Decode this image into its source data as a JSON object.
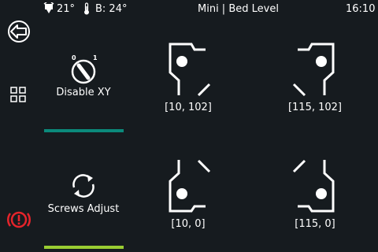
{
  "status": {
    "extruder_icon": "extruder-nozzle-icon",
    "extruder_temp": "21°",
    "bed_icon": "thermometer-icon",
    "bed_temp": "B: 24°",
    "title": "Mini | Bed Level",
    "time": "16:10"
  },
  "sidebar": {
    "back_icon": "back-arrow-icon",
    "menu_icon": "grid-menu-icon",
    "alert_icon": "emergency-stop-icon",
    "alert_color": "#e5242b"
  },
  "actions": {
    "disable_xy": {
      "label": "Disable XY",
      "switch_off": "0",
      "switch_on": "1",
      "icon": "toggle-switch-icon",
      "bar_color": "#0b8a7b"
    },
    "screws_adjust": {
      "label": "Screws Adjust",
      "icon": "refresh-cycle-icon",
      "bar_color": "#9acd32"
    }
  },
  "bed_points": [
    {
      "label": "[10, 102]",
      "position": "back-left"
    },
    {
      "label": "[115, 102]",
      "position": "back-right"
    },
    {
      "label": "[10, 0]",
      "position": "front-left"
    },
    {
      "label": "[115, 0]",
      "position": "front-right"
    }
  ]
}
